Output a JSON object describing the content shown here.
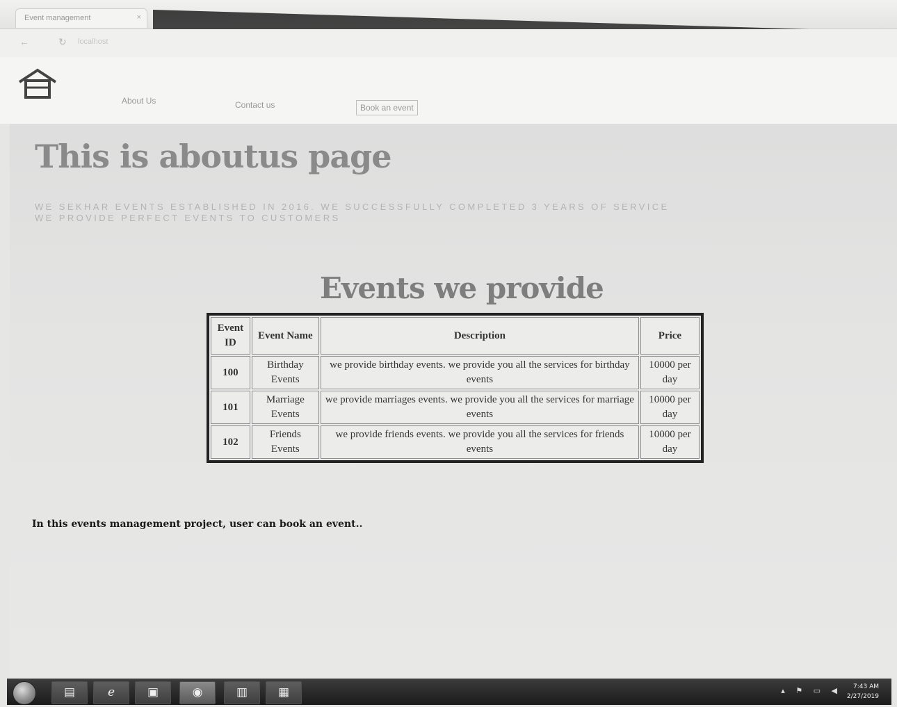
{
  "browser": {
    "tab_label": "Event management",
    "tab_close": "×",
    "back_glyph": "←",
    "reload_glyph": "↻",
    "address": "localhost",
    "window_controls": "– ▫ ×"
  },
  "header": {
    "home_icon": "home-icon",
    "nav": [
      {
        "label": "About Us"
      },
      {
        "label": "Contact us"
      },
      {
        "label": "Book an event"
      }
    ]
  },
  "main": {
    "title": "This is aboutus page",
    "about_line1": "WE SEKHAR EVENTS ESTABLISHED IN 2016. WE SUCCESSFULLY COMPLETED 3 YEARS OF SERVICE",
    "about_line2": "WE PROVIDE PERFECT EVENTS TO CUSTOMERS",
    "section_title": "Events we provide",
    "table": {
      "headers": [
        "Event ID",
        "Event Name",
        "Description",
        "Price"
      ],
      "rows": [
        {
          "id": "100",
          "name": "Birthday Events",
          "description": "we provide birthday events. we provide you all the services for birthday events",
          "price": "10000 per day"
        },
        {
          "id": "101",
          "name": "Marriage Events",
          "description": "we provide marriages events. we provide you all the services for marriage events",
          "price": "10000 per day"
        },
        {
          "id": "102",
          "name": "Friends Events",
          "description": "we provide friends events. we provide you all the services for friends events",
          "price": "10000 per day"
        }
      ]
    },
    "footer_note": "In this events management project, user can book an event.."
  },
  "taskbar": {
    "start_icon": "windows-start-icon",
    "apps": [
      {
        "icon": "file-explorer-icon",
        "glyph": "▤"
      },
      {
        "icon": "internet-explorer-icon",
        "glyph": "e"
      },
      {
        "icon": "media-player-icon",
        "glyph": "▣"
      },
      {
        "icon": "chrome-icon",
        "glyph": "◉"
      },
      {
        "icon": "paint-icon",
        "glyph": "▥"
      },
      {
        "icon": "app-icon",
        "glyph": "▦"
      }
    ],
    "tray_glyphs": "▴ ⚑ ▭ ◀",
    "clock_time": "7:43 AM",
    "clock_date": "2/27/2019"
  },
  "colors": {
    "page_bg": "#e6e6e4",
    "title_text": "#8a8a8a",
    "table_border": "#222222",
    "taskbar": "#222222"
  }
}
